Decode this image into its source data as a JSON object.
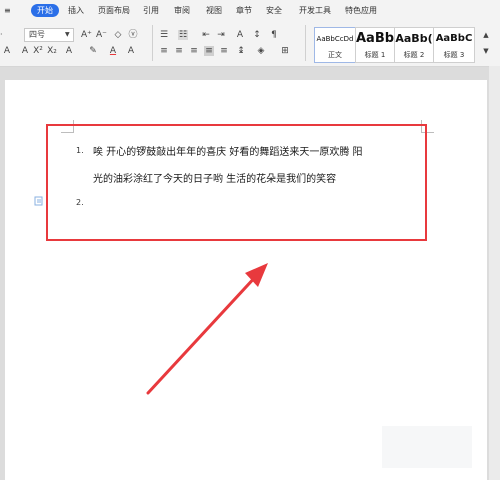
{
  "tabs": [
    {
      "label": "开始"
    },
    {
      "label": "插入"
    },
    {
      "label": "页面布局"
    },
    {
      "label": "引用"
    },
    {
      "label": "审阅"
    },
    {
      "label": "视图"
    },
    {
      "label": "章节"
    },
    {
      "label": "安全"
    },
    {
      "label": "开发工具"
    },
    {
      "label": "特色应用"
    }
  ],
  "toolbar": {
    "font_size": "四号",
    "colors": {
      "accent": "#2b6fe8",
      "highlight_red": "#e8393d"
    }
  },
  "styles": [
    {
      "preview": "AaBbCcDd",
      "name": "正文"
    },
    {
      "preview": "AaBb",
      "name": "标题 1"
    },
    {
      "preview": "AaBb(",
      "name": "标题 2"
    },
    {
      "preview": "AaBbC",
      "name": "标题 3"
    }
  ],
  "document": {
    "list_numbers": [
      "1.",
      "2."
    ],
    "line1": "唉  开心的锣鼓敲出年年的喜庆  好看的舞蹈送来天一原欢腾  阳",
    "line2": "光的油彩涂红了今天的日子哟  生活的花朵是我们的笑容"
  }
}
